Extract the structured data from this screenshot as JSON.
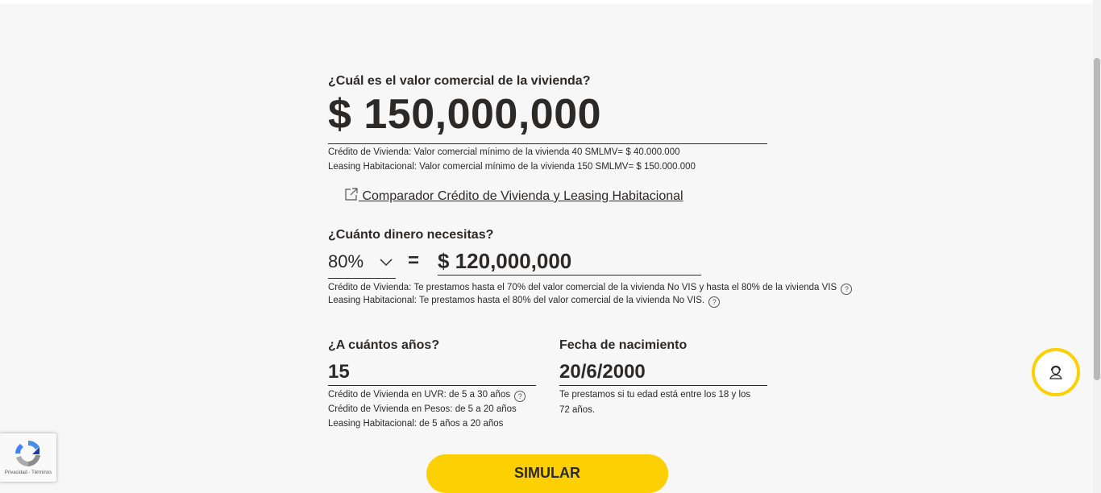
{
  "value_section": {
    "question": "¿Cuál es el valor comercial de la vivienda?",
    "amount": "$ 150,000,000",
    "note_credito": "Crédito de Vivienda: Valor comercial mínimo de la vivienda 40 SMLMV= $ 40.000.000",
    "note_leasing": "Leasing Habitacional: Valor comercial mínimo de la vivienda 150 SMLMV= $ 150.000.000"
  },
  "comparator_link": {
    "label": " Comparador Crédito de Vivienda y Leasing Habitacional",
    "icon": "external-link-icon"
  },
  "money_section": {
    "question": "¿Cuánto dinero necesitas?",
    "percent_selected": "80%",
    "equals": "=",
    "amount": "$ 120,000,000",
    "note_credito": "Crédito de Vivienda: Te prestamos hasta el 70% del valor comercial de la vivienda No VIS y hasta el 80% de la vivienda VIS",
    "note_leasing": "Leasing Habitacional: Te prestamos hasta el 80% del valor comercial de la vivienda No VIS.",
    "help_glyph": "?"
  },
  "years_section": {
    "question": "¿A cuántos años?",
    "value": "15",
    "note_uvr": "Crédito de Vivienda en UVR: de 5 a 30 años",
    "note_pesos": "Crédito de Vivienda en Pesos: de 5 a 20 años",
    "note_leasing": "Leasing Habitacional: de 5 años a 20 años"
  },
  "birth_section": {
    "question": "Fecha de nacimiento",
    "value": "20/6/2000",
    "note": "Te prestamos si tu edad está entre los 18 y los 72 años."
  },
  "actions": {
    "simular_label": "SIMULAR"
  },
  "support": {
    "icon": "support-agent-icon"
  },
  "recaptcha": {
    "links": "Privacidad - Términos"
  },
  "colors": {
    "accent_yellow": "#fdd003",
    "text": "#2c2a29",
    "background": "#f7f7f7"
  }
}
